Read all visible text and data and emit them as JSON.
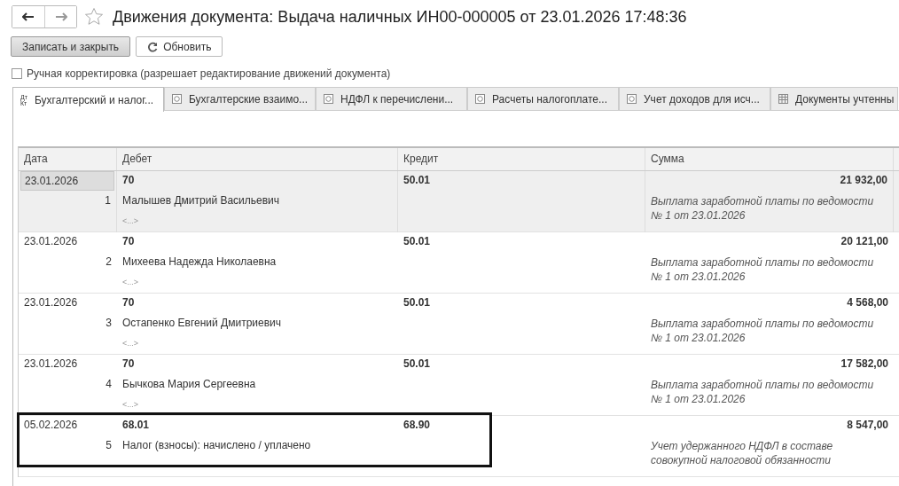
{
  "window": {
    "title": "Движения документа: Выдача наличных ИН00-000005 от 23.01.2026 17:48:36",
    "favorite": false
  },
  "toolbar": {
    "buttons": [
      {
        "label": "Записать и закрыть",
        "kind": "primary"
      },
      {
        "label": "Обновить",
        "kind": "refresh"
      }
    ]
  },
  "manual_edit": {
    "label": "Ручная корректировка (разрешает редактирование движений документа)",
    "checked": false
  },
  "tabs": [
    {
      "label": "Бухгалтерский и налог...",
      "kind": "ledger",
      "icon_text": [
        "Дт",
        "Кт"
      ],
      "selected": true
    },
    {
      "label": "Бухгалтерские взаимо...",
      "kind": "register",
      "selected": false
    },
    {
      "label": "НДФЛ к перечислени...",
      "kind": "register",
      "selected": false
    },
    {
      "label": "Расчеты налогоплате...",
      "kind": "register",
      "selected": false
    },
    {
      "label": "Учет доходов для исч...",
      "kind": "register",
      "selected": false
    },
    {
      "label": "Документы учтенны",
      "kind": "table",
      "selected": false
    }
  ],
  "table": {
    "columns": [
      "Дата",
      "Дебет",
      "Кредит",
      "Сумма"
    ],
    "rows": [
      {
        "date": "23.01.2026",
        "number": "1",
        "debit": "70",
        "subconto": "Малышев Дмитрий Васильевич",
        "subconto_2": "<...>",
        "credit": "50.01",
        "amount": "21 932,00",
        "description": "Выплата заработной платы по ведомости № 1 от 23.01.2026",
        "selected": true,
        "highlighted": false
      },
      {
        "date": "23.01.2026",
        "number": "2",
        "debit": "70",
        "subconto": "Михеева Надежда Николаевна",
        "subconto_2": "<...>",
        "credit": "50.01",
        "amount": "20 121,00",
        "description": "Выплата заработной платы по ведомости № 1 от 23.01.2026",
        "selected": false,
        "highlighted": false
      },
      {
        "date": "23.01.2026",
        "number": "3",
        "debit": "70",
        "subconto": "Остапенко Евгений Дмитриевич",
        "subconto_2": "<...>",
        "credit": "50.01",
        "amount": "4 568,00",
        "description": "Выплата заработной платы по ведомости № 1 от 23.01.2026",
        "selected": false,
        "highlighted": false
      },
      {
        "date": "23.01.2026",
        "number": "4",
        "debit": "70",
        "subconto": "Бычкова Мария Сергеевна",
        "subconto_2": "<...>",
        "credit": "50.01",
        "amount": "17 582,00",
        "description": "Выплата заработной платы по ведомости № 1 от 23.01.2026",
        "selected": false,
        "highlighted": false
      },
      {
        "date": "05.02.2026",
        "number": "5",
        "debit": "68.01",
        "subconto": "Налог (взносы): начислено / уплачено",
        "credit": "68.90",
        "amount": "8 547,00",
        "description": "Учет удержанного НДФЛ в составе совокупной налоговой обязанности",
        "selected": false,
        "highlighted": true
      }
    ]
  }
}
